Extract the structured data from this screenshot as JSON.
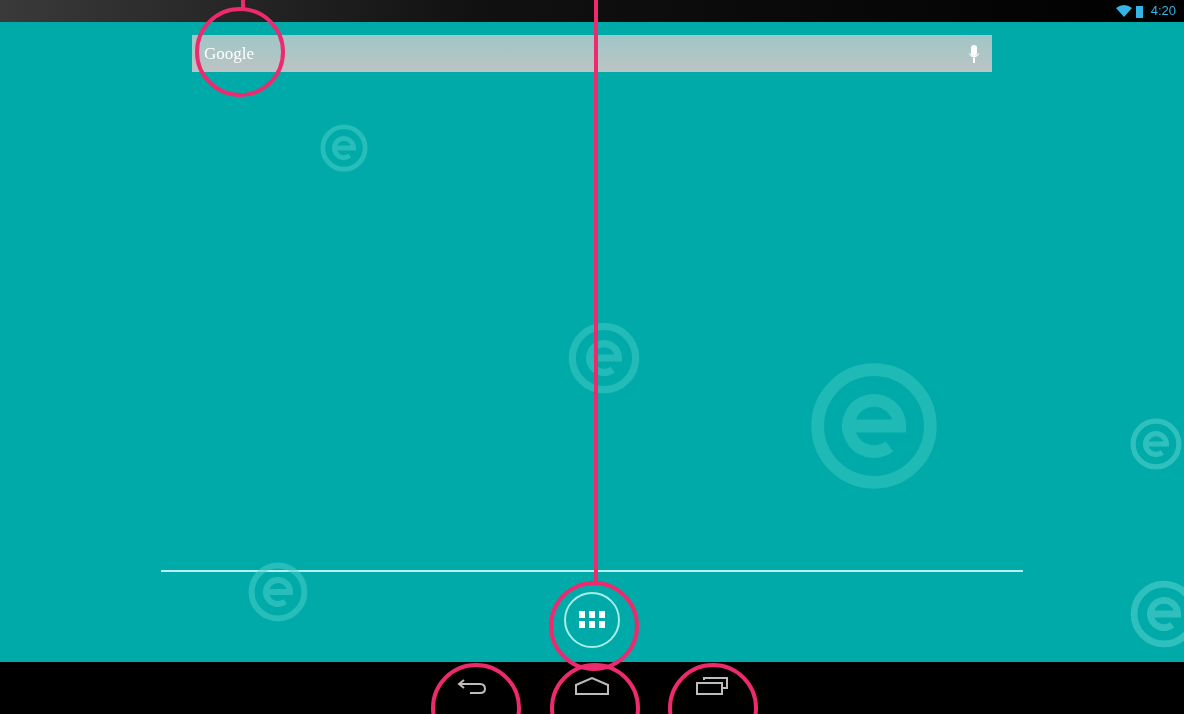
{
  "status_bar": {
    "time": "4:20"
  },
  "search_bar": {
    "label": "Google"
  },
  "navigation_bar": {
    "buttons": [
      {
        "kind": "back"
      },
      {
        "kind": "home"
      },
      {
        "kind": "recents"
      }
    ]
  }
}
